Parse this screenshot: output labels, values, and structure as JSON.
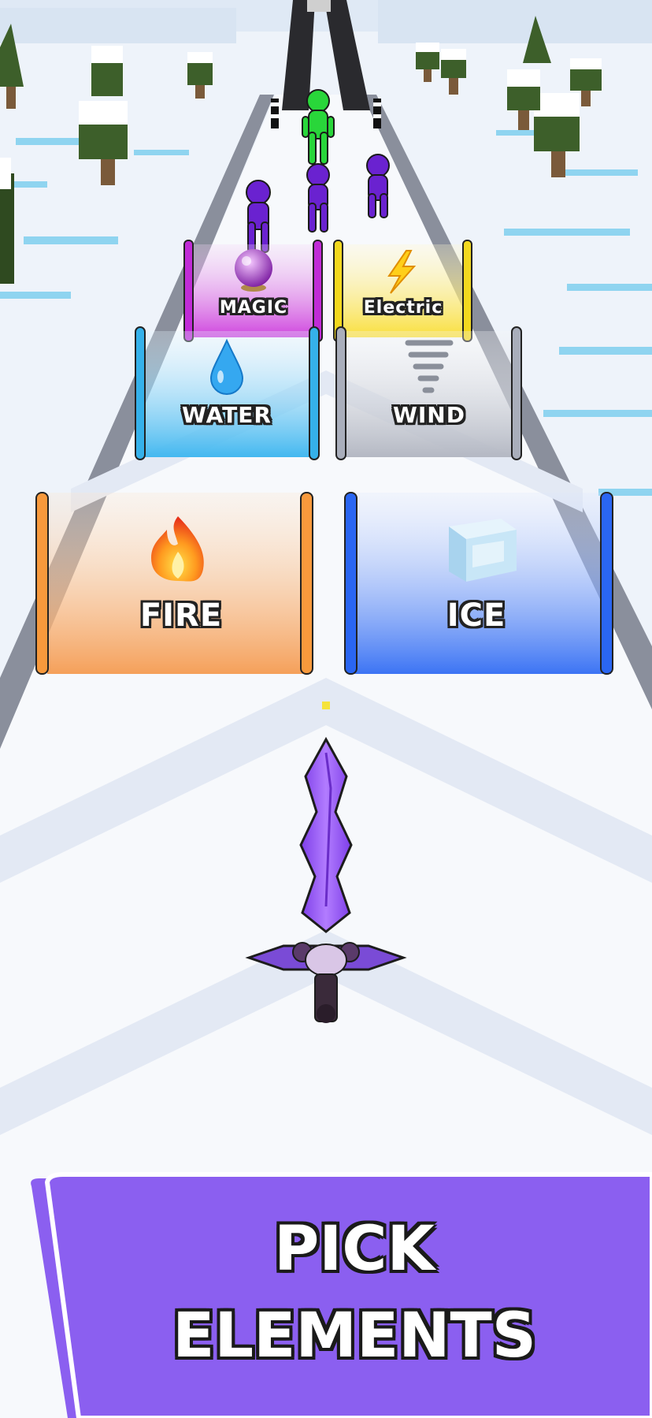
{
  "gates": {
    "magic": {
      "label": "MAGIC",
      "icon": "crystal-ball-icon",
      "color": "#c02bd6"
    },
    "electric": {
      "label": "Electric",
      "icon": "lightning-icon",
      "color": "#f2d81f"
    },
    "water": {
      "label": "WATER",
      "icon": "water-drop-icon",
      "color": "#35b1ea"
    },
    "wind": {
      "label": "WIND",
      "icon": "tornado-icon",
      "color": "#a9aebb"
    },
    "fire": {
      "label": "FIRE",
      "icon": "flame-icon",
      "color": "#f7993c"
    },
    "ice": {
      "label": "ICE",
      "icon": "ice-cube-icon",
      "color": "#2a66f2"
    }
  },
  "banner": {
    "line1": "PICK",
    "line2": "ELEMENTS",
    "color": "#8b5ff0"
  },
  "player": {
    "weapon": "sword-icon",
    "color": "#9b59f5"
  },
  "enemies": {
    "leader_color": "#29d63a",
    "minion_color": "#6a22d0"
  }
}
